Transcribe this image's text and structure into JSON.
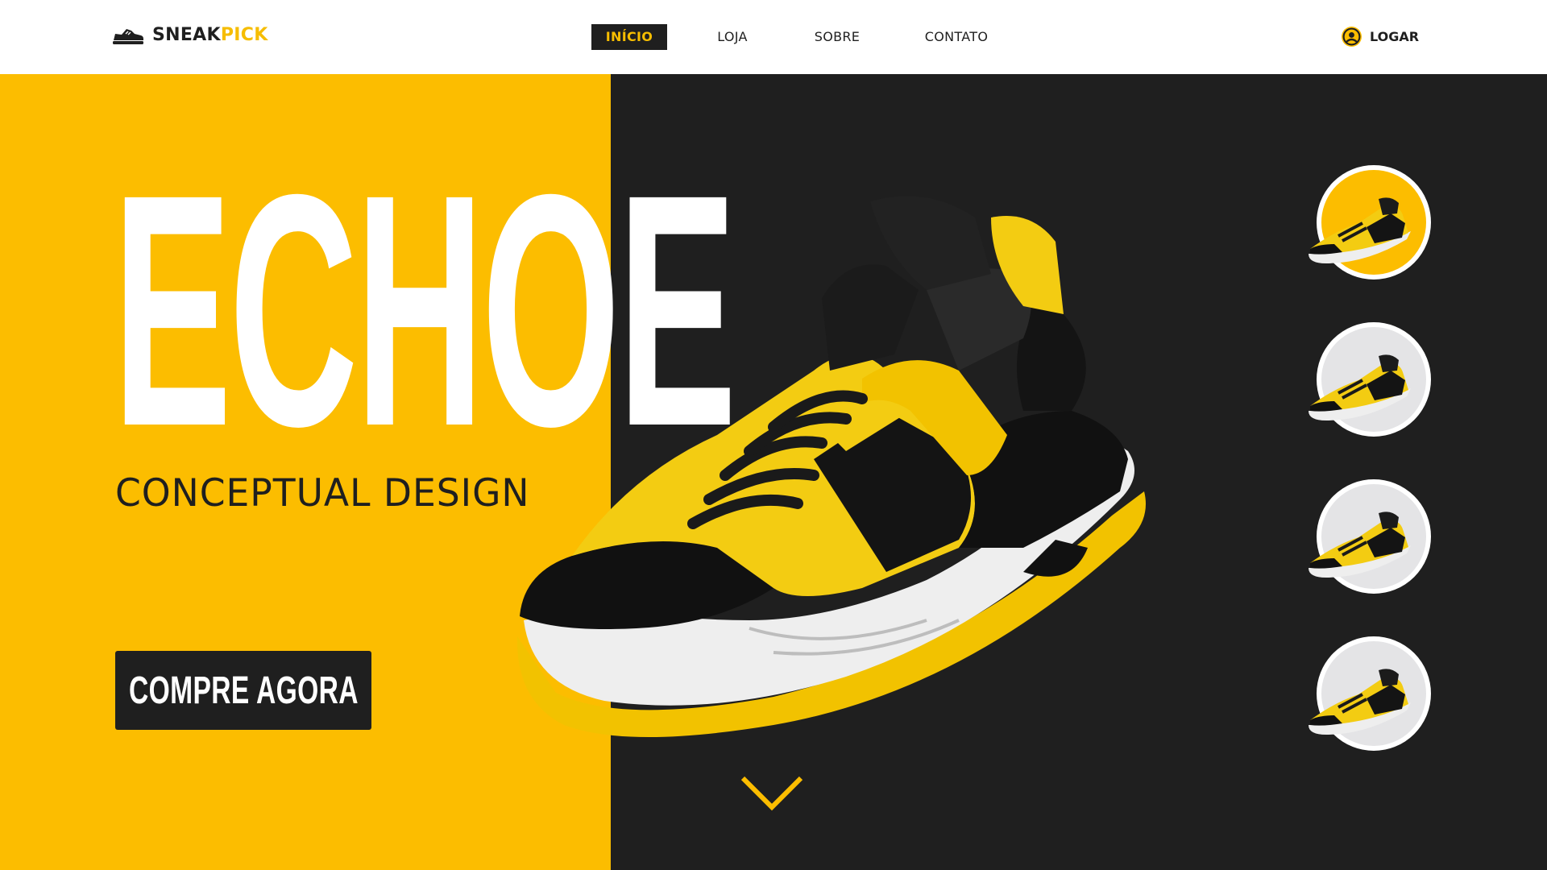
{
  "brand": {
    "name_part1": "SNEAK",
    "name_part2": "PICK",
    "icon": "sneaker-logo-icon"
  },
  "nav": {
    "items": [
      {
        "label": "INÍCIO",
        "active": true
      },
      {
        "label": "LOJA",
        "active": false
      },
      {
        "label": "SOBRE",
        "active": false
      },
      {
        "label": "CONTATO",
        "active": false
      }
    ]
  },
  "login": {
    "label": "LOGAR",
    "icon": "user-circle-icon"
  },
  "hero": {
    "title": "ECHOE",
    "subtitle": "CONCEPTUAL DESIGN",
    "cta_label": "COMPRE AGORA",
    "scroll_icon": "chevron-down-icon"
  },
  "thumbnails": [
    {
      "selected": true,
      "ring_color": "#fcbd00"
    },
    {
      "selected": false,
      "ring_color": "#e4e4e6"
    },
    {
      "selected": false,
      "ring_color": "#e4e4e6"
    },
    {
      "selected": false,
      "ring_color": "#e4e4e6"
    }
  ],
  "colors": {
    "accent_yellow": "#fcbd00",
    "dark": "#1f1f1f",
    "white": "#ffffff"
  }
}
